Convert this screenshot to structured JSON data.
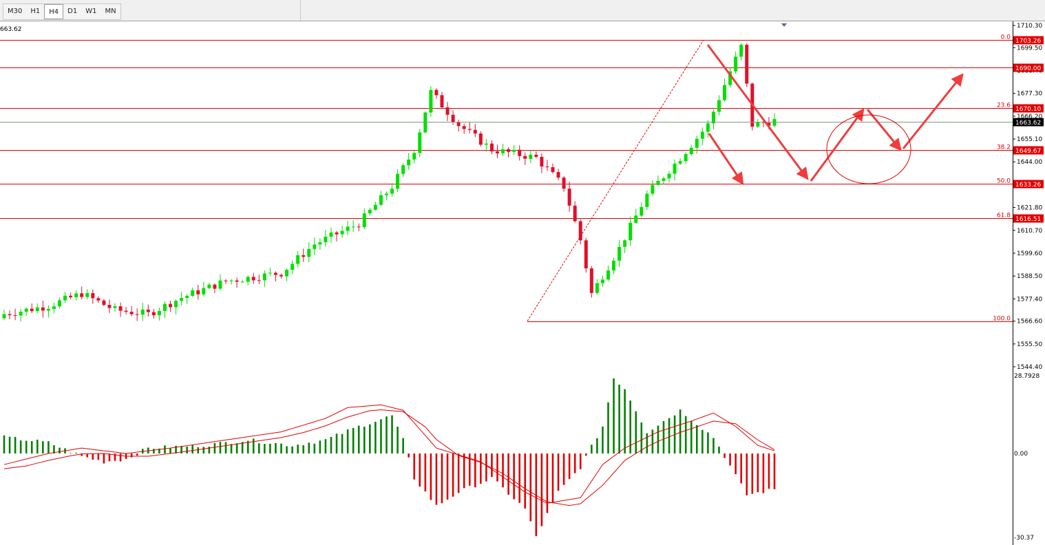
{
  "toolbar": {
    "timeframes": [
      "M30",
      "H1",
      "H4",
      "D1",
      "W1",
      "MN"
    ],
    "active": "H4"
  },
  "colors": {
    "bull": "#00e000",
    "bear": "#e0102a",
    "fib_line": "#e00000",
    "macd_pos": "#008000",
    "macd_neg": "#e00000",
    "signal": "#e00000",
    "annotation": "#f03c3c",
    "current_line": "#7a9a7a"
  },
  "chart_data": {
    "type": "candlestick",
    "price_axis": {
      "ticks": [
        "1710.30",
        "1699.50",
        "1688.40",
        "1677.30",
        "1666.20",
        "1655.10",
        "1644.00",
        "1621.80",
        "1610.70",
        "1599.60",
        "1588.50",
        "1577.40",
        "1566.60",
        "1555.50",
        "1544.40"
      ],
      "ylim": [
        1539,
        1714
      ]
    },
    "current_price": "1663.62",
    "top_left_price": "663.62",
    "fib_levels": [
      {
        "ratio": "0.0",
        "price": "1703.26"
      },
      {
        "ratio": "",
        "price": "1690.00"
      },
      {
        "ratio": "23.6",
        "price": "1670.10"
      },
      {
        "ratio": "38.2",
        "price": "1649.67"
      },
      {
        "ratio": "50.0",
        "price": "1633.26"
      },
      {
        "ratio": "61.8",
        "price": "1616.51"
      },
      {
        "ratio": "100.0",
        "price": "1566.60"
      }
    ],
    "candle_count": 140,
    "anchor_closes": [
      [
        0,
        1570
      ],
      [
        8,
        1574
      ],
      [
        14,
        1580
      ],
      [
        20,
        1572
      ],
      [
        26,
        1570
      ],
      [
        32,
        1578
      ],
      [
        40,
        1586
      ],
      [
        50,
        1590
      ],
      [
        56,
        1604
      ],
      [
        64,
        1614
      ],
      [
        70,
        1632
      ],
      [
        74,
        1650
      ],
      [
        77,
        1678
      ],
      [
        82,
        1662
      ],
      [
        88,
        1650
      ],
      [
        96,
        1646
      ],
      [
        101,
        1632
      ],
      [
        104,
        1606
      ],
      [
        106,
        1580
      ],
      [
        111,
        1602
      ],
      [
        116,
        1628
      ],
      [
        122,
        1646
      ],
      [
        127,
        1662
      ],
      [
        131,
        1688
      ],
      [
        133,
        1700
      ],
      [
        135,
        1662
      ],
      [
        139,
        1664
      ]
    ],
    "macd_axis": {
      "ticks": [
        "28.7928",
        "0.00",
        "-30.37"
      ],
      "ylim": [
        -31,
        30
      ]
    },
    "macd_anchor": [
      [
        0,
        6
      ],
      [
        8,
        4
      ],
      [
        14,
        -1
      ],
      [
        18,
        -3
      ],
      [
        22,
        -2
      ],
      [
        26,
        2
      ],
      [
        36,
        3
      ],
      [
        44,
        5
      ],
      [
        52,
        3
      ],
      [
        58,
        5
      ],
      [
        64,
        10
      ],
      [
        70,
        14
      ],
      [
        72,
        5
      ],
      [
        74,
        -9
      ],
      [
        78,
        -19
      ],
      [
        82,
        -14
      ],
      [
        88,
        -9
      ],
      [
        94,
        -20
      ],
      [
        96,
        -30
      ],
      [
        100,
        -14
      ],
      [
        104,
        -5
      ],
      [
        108,
        10
      ],
      [
        110,
        28
      ],
      [
        112,
        24
      ],
      [
        116,
        8
      ],
      [
        122,
        16
      ],
      [
        128,
        6
      ],
      [
        130,
        -1
      ],
      [
        134,
        -15
      ],
      [
        139,
        -13
      ]
    ],
    "signal_anchor": [
      [
        0,
        -4
      ],
      [
        8,
        0
      ],
      [
        14,
        2
      ],
      [
        22,
        0
      ],
      [
        30,
        2
      ],
      [
        40,
        5
      ],
      [
        50,
        8
      ],
      [
        58,
        13
      ],
      [
        62,
        17
      ],
      [
        68,
        18
      ],
      [
        72,
        16
      ],
      [
        78,
        2
      ],
      [
        86,
        -3
      ],
      [
        94,
        -14
      ],
      [
        98,
        -18
      ],
      [
        104,
        -16
      ],
      [
        108,
        -4
      ],
      [
        112,
        2
      ],
      [
        118,
        8
      ],
      [
        124,
        12
      ],
      [
        128,
        15
      ],
      [
        132,
        10
      ],
      [
        136,
        3
      ],
      [
        139,
        1
      ]
    ]
  }
}
